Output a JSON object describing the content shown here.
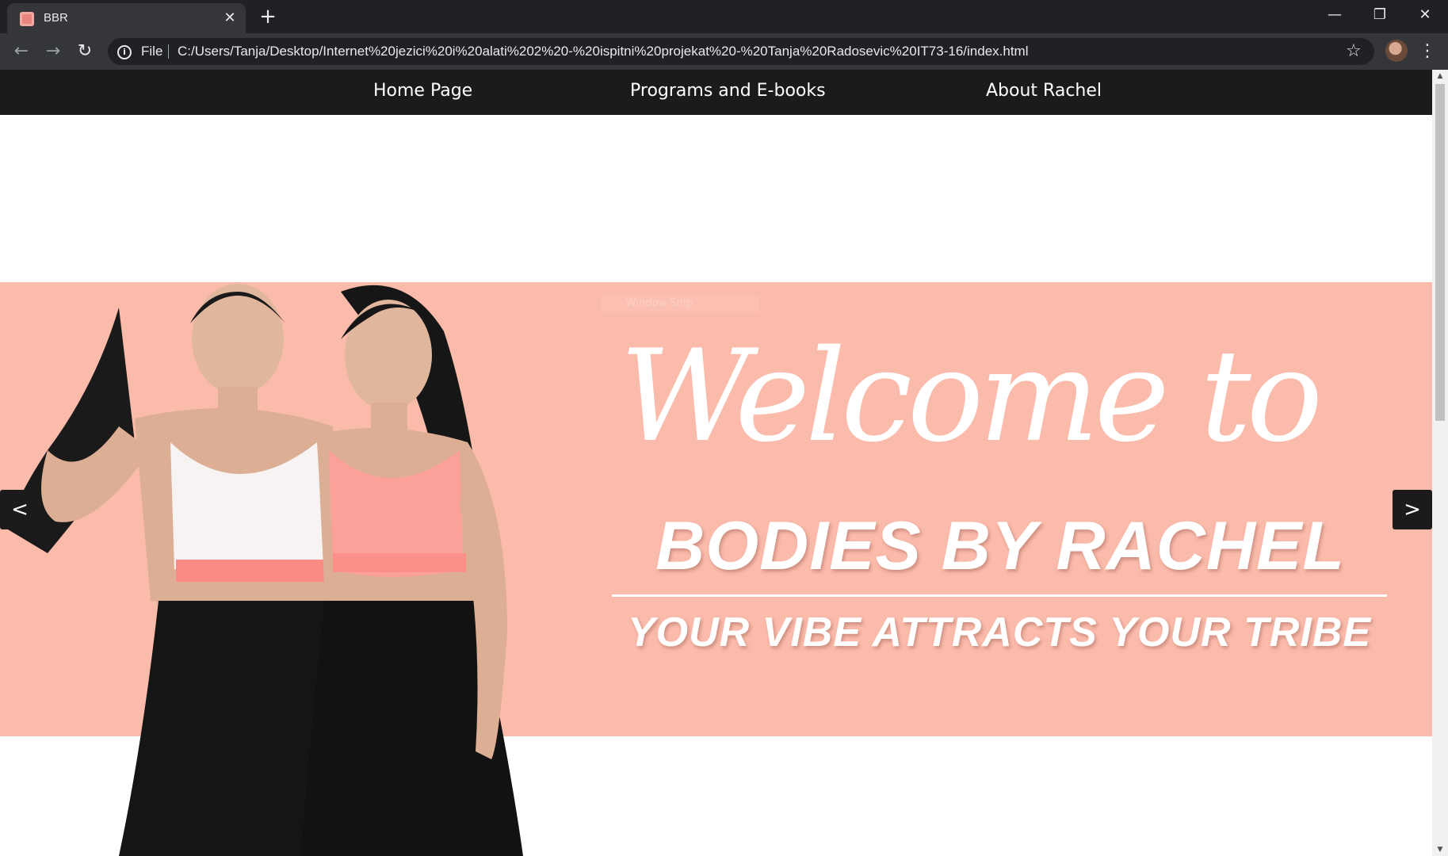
{
  "browser": {
    "tab": {
      "title": "BBR",
      "close": "✕"
    },
    "new_tab": "+",
    "window_controls": {
      "minimize": "—",
      "restore": "❐",
      "close": "✕"
    },
    "nav": {
      "back": "←",
      "forward": "→",
      "reload": "↻"
    },
    "omnibox": {
      "scheme_label": "File",
      "url": "C:/Users/Tanja/Desktop/Internet%20jezici%20i%20alati%202%20-%20ispitni%20projekat%20-%20Tanja%20Radosevic%20IT73-16/index.html"
    },
    "bookmark_star": "☆",
    "menu": "⋮"
  },
  "site_nav": {
    "items": [
      {
        "label": "Home Page"
      },
      {
        "label": "Programs and E-books"
      },
      {
        "label": "About Rachel"
      }
    ]
  },
  "hero": {
    "script_title": "Welcome to",
    "brand": "BODIES BY RACHEL",
    "tagline": "YOUR VIBE ATTRACTS YOUR TRIBE",
    "overlay_hint": "Window Snip",
    "prev": "<",
    "next": ">",
    "background_color": "#fbbbab"
  },
  "scrollbar": {
    "up": "▲",
    "down": "▼"
  }
}
